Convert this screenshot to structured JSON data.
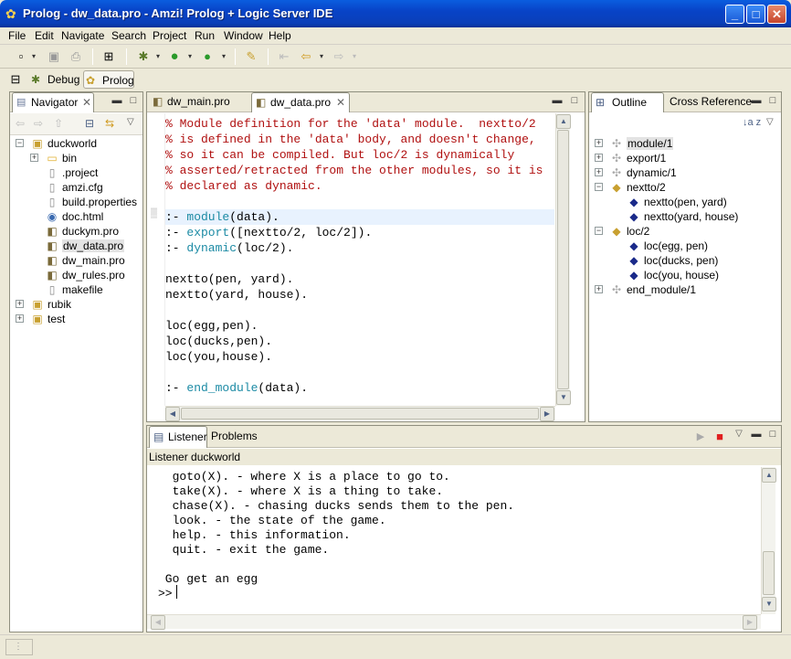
{
  "window": {
    "title": "Prolog - dw_data.pro - Amzi! Prolog + Logic Server IDE",
    "minimize": "_",
    "maximize": "□",
    "close": "✕"
  },
  "menu": [
    "File",
    "Edit",
    "Navigate",
    "Search",
    "Project",
    "Run",
    "Window",
    "Help"
  ],
  "perspectives": [
    {
      "label": "Debug",
      "icon": "debug-perspective-icon"
    },
    {
      "label": "Prolog",
      "icon": "prolog-perspective-icon",
      "active": true
    }
  ],
  "navigator": {
    "tab": "Navigator",
    "tree": [
      {
        "label": "duckworld",
        "depth": 0,
        "expanded": true,
        "icon": "project-icon"
      },
      {
        "label": "bin",
        "depth": 1,
        "collapsed": true,
        "icon": "folder-icon"
      },
      {
        "label": ".project",
        "depth": 1,
        "icon": "file-icon"
      },
      {
        "label": "amzi.cfg",
        "depth": 1,
        "icon": "file-icon"
      },
      {
        "label": "build.properties",
        "depth": 1,
        "icon": "file-icon"
      },
      {
        "label": "doc.html",
        "depth": 1,
        "icon": "globe-icon"
      },
      {
        "label": "duckym.pro",
        "depth": 1,
        "icon": "prolog-file-icon"
      },
      {
        "label": "dw_data.pro",
        "depth": 1,
        "icon": "prolog-file-icon",
        "selected": true
      },
      {
        "label": "dw_main.pro",
        "depth": 1,
        "icon": "prolog-file-icon"
      },
      {
        "label": "dw_rules.pro",
        "depth": 1,
        "icon": "prolog-file-icon"
      },
      {
        "label": "makefile",
        "depth": 1,
        "icon": "file-icon"
      },
      {
        "label": "rubik",
        "depth": 0,
        "collapsed": true,
        "icon": "project-icon"
      },
      {
        "label": "test",
        "depth": 0,
        "collapsed": true,
        "icon": "project-icon"
      }
    ]
  },
  "editor": {
    "tabs": [
      {
        "label": "dw_main.pro",
        "icon": "prolog-file-icon"
      },
      {
        "label": "dw_data.pro",
        "icon": "prolog-file-icon",
        "active": true,
        "close": "✕"
      }
    ],
    "lines": [
      {
        "parts": [
          {
            "t": "% Module definition for the 'data' module.  nextto/2",
            "c": "cmt"
          }
        ]
      },
      {
        "parts": [
          {
            "t": "% is defined in the 'data' body, and doesn't change,",
            "c": "cmt"
          }
        ]
      },
      {
        "parts": [
          {
            "t": "% so it can be compiled. But loc/2 is dynamically",
            "c": "cmt"
          }
        ]
      },
      {
        "parts": [
          {
            "t": "% asserted/retracted from the other modules, so it is",
            "c": "cmt"
          }
        ]
      },
      {
        "parts": [
          {
            "t": "% declared as dynamic.",
            "c": "cmt"
          }
        ]
      },
      {
        "parts": [
          {
            "t": "",
            "c": ""
          }
        ]
      },
      {
        "parts": [
          {
            "t": ":- ",
            "c": ""
          },
          {
            "t": "module",
            "c": "kw"
          },
          {
            "t": "(data).",
            "c": ""
          }
        ],
        "current": true
      },
      {
        "parts": [
          {
            "t": ":- ",
            "c": ""
          },
          {
            "t": "export",
            "c": "kw"
          },
          {
            "t": "([nextto/2, loc/2]).",
            "c": ""
          }
        ]
      },
      {
        "parts": [
          {
            "t": ":- ",
            "c": ""
          },
          {
            "t": "dynamic",
            "c": "kw"
          },
          {
            "t": "(loc/2).",
            "c": ""
          }
        ]
      },
      {
        "parts": [
          {
            "t": "",
            "c": ""
          }
        ]
      },
      {
        "parts": [
          {
            "t": "nextto(pen, yard).",
            "c": ""
          }
        ]
      },
      {
        "parts": [
          {
            "t": "nextto(yard, house).",
            "c": ""
          }
        ]
      },
      {
        "parts": [
          {
            "t": "",
            "c": ""
          }
        ]
      },
      {
        "parts": [
          {
            "t": "loc(egg,pen).",
            "c": ""
          }
        ]
      },
      {
        "parts": [
          {
            "t": "loc(ducks,pen).",
            "c": ""
          }
        ]
      },
      {
        "parts": [
          {
            "t": "loc(you,house).",
            "c": ""
          }
        ]
      },
      {
        "parts": [
          {
            "t": "",
            "c": ""
          }
        ]
      },
      {
        "parts": [
          {
            "t": ":- ",
            "c": ""
          },
          {
            "t": "end_module",
            "c": "kw"
          },
          {
            "t": "(data).",
            "c": ""
          }
        ]
      }
    ]
  },
  "outline": {
    "tabs": [
      "Outline",
      "Cross Reference"
    ],
    "sort_label": "↓a z",
    "tree": [
      {
        "label": "module/1",
        "depth": 0,
        "icon": "directive-icon",
        "selected": true
      },
      {
        "label": "export/1",
        "depth": 0,
        "icon": "directive-icon"
      },
      {
        "label": "dynamic/1",
        "depth": 0,
        "icon": "directive-icon"
      },
      {
        "label": "nextto/2",
        "depth": 0,
        "expanded": true,
        "icon": "predicate-icon"
      },
      {
        "label": "nextto(pen, yard)",
        "depth": 1,
        "icon": "clause-icon"
      },
      {
        "label": "nextto(yard, house)",
        "depth": 1,
        "icon": "clause-icon"
      },
      {
        "label": "loc/2",
        "depth": 0,
        "expanded": true,
        "icon": "predicate-icon"
      },
      {
        "label": "loc(egg, pen)",
        "depth": 1,
        "icon": "clause-icon"
      },
      {
        "label": "loc(ducks, pen)",
        "depth": 1,
        "icon": "clause-icon"
      },
      {
        "label": "loc(you, house)",
        "depth": 1,
        "icon": "clause-icon"
      },
      {
        "label": "end_module/1",
        "depth": 0,
        "icon": "directive-icon"
      }
    ]
  },
  "listener": {
    "tabs": [
      "Listener",
      "Problems"
    ],
    "title": "Listener duckworld",
    "lines": [
      "  goto(X). - where X is a place to go to.",
      "  take(X). - where X is a thing to take.",
      "  chase(X). - chasing ducks sends them to the pen.",
      "  look. - the state of the game.",
      "  help. - this information.",
      "  quit. - exit the game.",
      "",
      " Go get an egg",
      ">> "
    ]
  },
  "colors": {
    "comment": "#b01010",
    "keyword": "#1b8aa4",
    "titlebar": "#0843c7",
    "stop": "#e02020",
    "run": "#2a9a2a"
  }
}
